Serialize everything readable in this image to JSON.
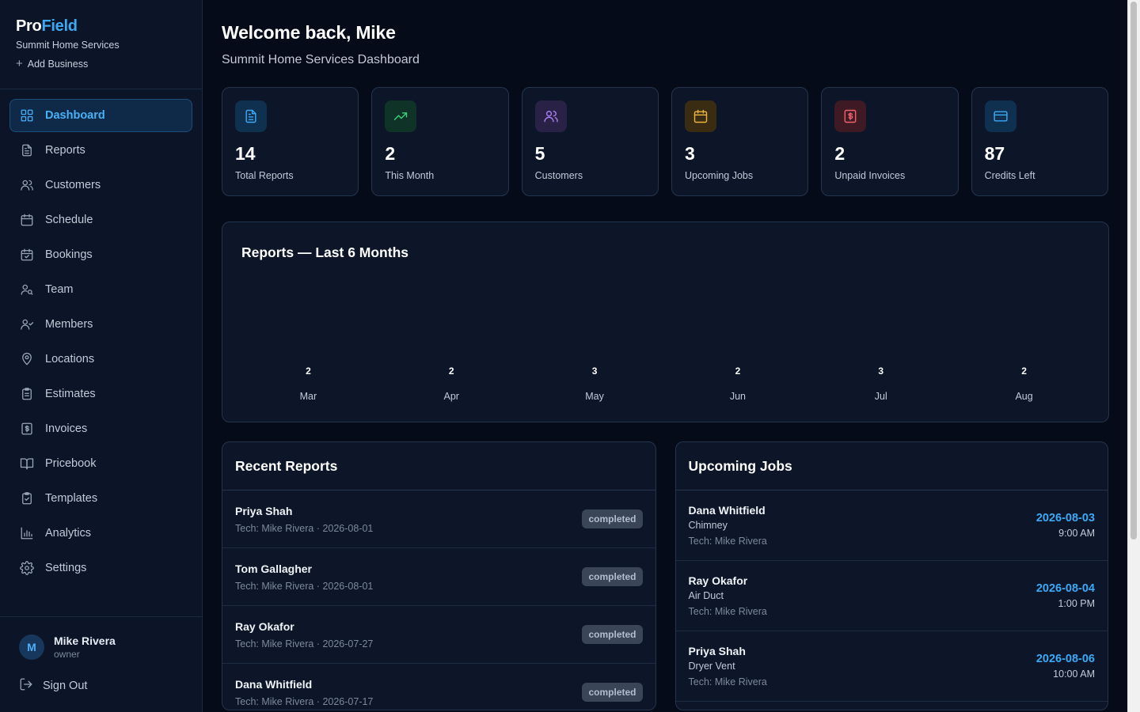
{
  "brand": {
    "logo_pro": "Pro",
    "logo_field": "Field",
    "business": "Summit Home Services",
    "add_business": "Add Business"
  },
  "nav": [
    {
      "label": "Dashboard",
      "icon": "grid-icon",
      "active": true
    },
    {
      "label": "Reports",
      "icon": "file-text-icon"
    },
    {
      "label": "Customers",
      "icon": "users-icon"
    },
    {
      "label": "Schedule",
      "icon": "calendar-icon"
    },
    {
      "label": "Bookings",
      "icon": "calendar-check-icon"
    },
    {
      "label": "Team",
      "icon": "team-icon"
    },
    {
      "label": "Members",
      "icon": "user-check-icon"
    },
    {
      "label": "Locations",
      "icon": "map-pin-icon"
    },
    {
      "label": "Estimates",
      "icon": "clipboard-list-icon"
    },
    {
      "label": "Invoices",
      "icon": "receipt-icon"
    },
    {
      "label": "Pricebook",
      "icon": "book-open-icon"
    },
    {
      "label": "Templates",
      "icon": "clipboard-check-icon"
    },
    {
      "label": "Analytics",
      "icon": "bar-chart-icon"
    },
    {
      "label": "Settings",
      "icon": "gear-icon"
    }
  ],
  "user": {
    "initial": "M",
    "name": "Mike Rivera",
    "role": "owner",
    "sign_out": "Sign Out"
  },
  "header": {
    "welcome": "Welcome back, Mike",
    "subtitle": "Summit Home Services Dashboard"
  },
  "stats": [
    {
      "value": "14",
      "label": "Total Reports",
      "icon": "file-text-icon",
      "color": "#3da9f5",
      "bg": "#10304f"
    },
    {
      "value": "2",
      "label": "This Month",
      "icon": "trending-up-icon",
      "color": "#3ecf7a",
      "bg": "#0f3427"
    },
    {
      "value": "5",
      "label": "Customers",
      "icon": "users-icon",
      "color": "#a97cf0",
      "bg": "#2a2147"
    },
    {
      "value": "3",
      "label": "Upcoming Jobs",
      "icon": "calendar-icon",
      "color": "#eab53a",
      "bg": "#3a2c12"
    },
    {
      "value": "2",
      "label": "Unpaid Invoices",
      "icon": "receipt-icon",
      "color": "#f0616b",
      "bg": "#3d1a24"
    },
    {
      "value": "87",
      "label": "Credits Left",
      "icon": "credit-card-icon",
      "color": "#3da9f5",
      "bg": "#10304f"
    }
  ],
  "chart_title": "Reports — Last 6 Months",
  "chart_data": {
    "type": "bar",
    "title": "Reports — Last 6 Months",
    "categories": [
      "Mar",
      "Apr",
      "May",
      "Jun",
      "Jul",
      "Aug"
    ],
    "values": [
      2,
      2,
      3,
      2,
      3,
      2
    ],
    "xlabel": "",
    "ylabel": "",
    "grid": false
  },
  "recent_reports": {
    "title": "Recent Reports",
    "items": [
      {
        "name": "Priya Shah",
        "sub": "Tech: Mike Rivera · 2026-08-01",
        "status": "completed"
      },
      {
        "name": "Tom Gallagher",
        "sub": "Tech: Mike Rivera · 2026-08-01",
        "status": "completed"
      },
      {
        "name": "Ray Okafor",
        "sub": "Tech: Mike Rivera · 2026-07-27",
        "status": "completed"
      },
      {
        "name": "Dana Whitfield",
        "sub": "Tech: Mike Rivera · 2026-07-17",
        "status": "completed"
      }
    ]
  },
  "upcoming_jobs": {
    "title": "Upcoming Jobs",
    "items": [
      {
        "name": "Dana Whitfield",
        "service": "Chimney",
        "tech": "Tech: Mike Rivera",
        "date": "2026-08-03",
        "time": "9:00 AM"
      },
      {
        "name": "Ray Okafor",
        "service": "Air Duct",
        "tech": "Tech: Mike Rivera",
        "date": "2026-08-04",
        "time": "1:00 PM"
      },
      {
        "name": "Priya Shah",
        "service": "Dryer Vent",
        "tech": "Tech: Mike Rivera",
        "date": "2026-08-06",
        "time": "10:00 AM"
      }
    ]
  }
}
